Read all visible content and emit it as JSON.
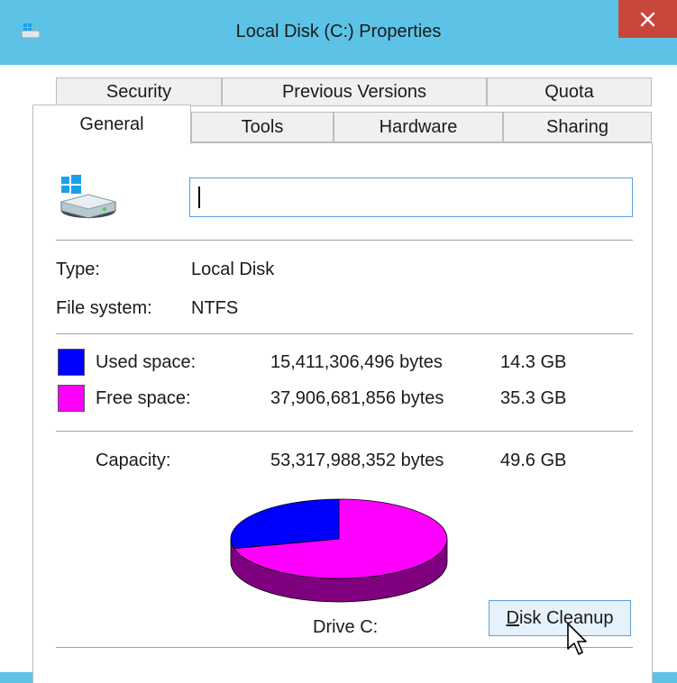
{
  "window": {
    "title": "Local Disk (C:) Properties",
    "close_glyph": "✕"
  },
  "tabs": {
    "row1": [
      "Security",
      "Previous Versions",
      "Quota"
    ],
    "row2": [
      "General",
      "Tools",
      "Hardware",
      "Sharing"
    ],
    "active": "General"
  },
  "general": {
    "name_value": "",
    "type_label": "Type:",
    "type_value": "Local Disk",
    "fs_label": "File system:",
    "fs_value": "NTFS",
    "used_label": "Used space:",
    "used_bytes": "15,411,306,496 bytes",
    "used_gb": "14.3 GB",
    "free_label": "Free space:",
    "free_bytes": "37,906,681,856 bytes",
    "free_gb": "35.3 GB",
    "capacity_label": "Capacity:",
    "capacity_bytes": "53,317,988,352 bytes",
    "capacity_gb": "49.6 GB",
    "drive_label": "Drive C:",
    "cleanup_button_mnemonic": "D",
    "cleanup_button_rest": "isk Cleanup"
  },
  "colors": {
    "used": "#0000ff",
    "free": "#ff00ff",
    "free_side": "#7f007f",
    "used_side": "#00007f",
    "title_bar": "#5cc3e6",
    "close": "#c9463d"
  },
  "chart_data": {
    "type": "pie",
    "labels": [
      "Used space",
      "Free space"
    ],
    "values": [
      15411306496,
      37906681856
    ]
  }
}
